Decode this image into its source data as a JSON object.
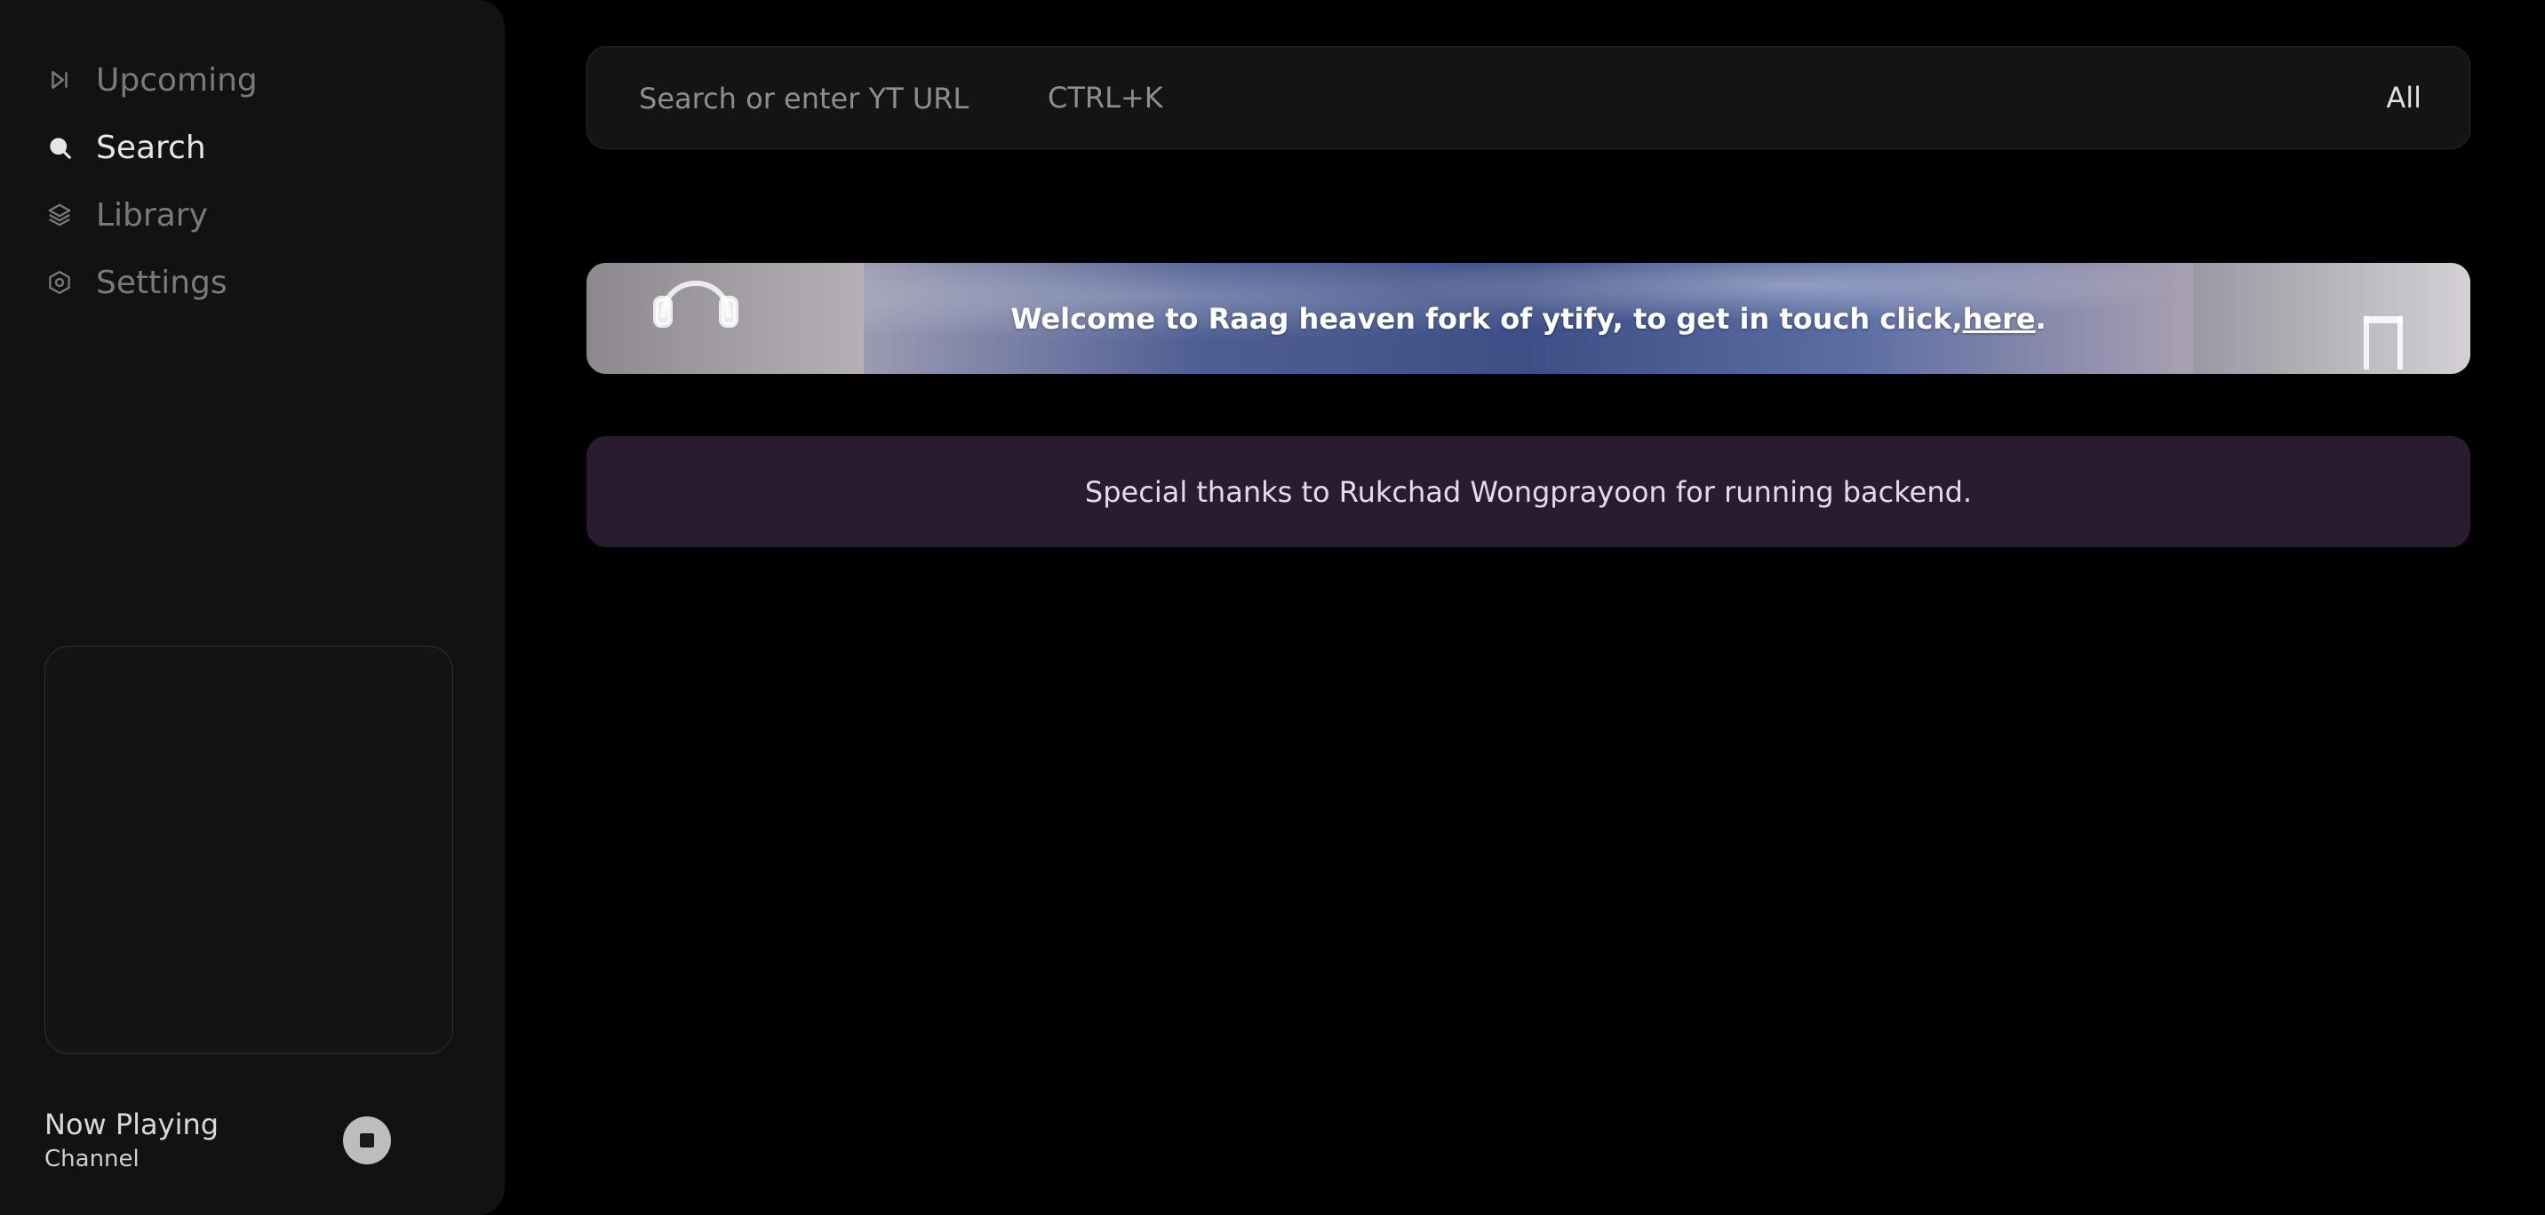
{
  "sidebar": {
    "items": [
      {
        "label": "Upcoming",
        "icon": "play-next-icon",
        "active": false
      },
      {
        "label": "Search",
        "icon": "search-icon",
        "active": true
      },
      {
        "label": "Library",
        "icon": "layers-icon",
        "active": false
      },
      {
        "label": "Settings",
        "icon": "settings-hexagon-icon",
        "active": false
      }
    ],
    "now_playing": {
      "title": "Now Playing",
      "channel": "Channel"
    }
  },
  "search": {
    "placeholder": "Search or enter YT URL",
    "shortcut": "CTRL+K",
    "filter": "All"
  },
  "banner": {
    "text_before": "Welcome to Raag heaven fork of ytify, to get in touch click, ",
    "link": "here",
    "text_after": "."
  },
  "thanks": {
    "text": "Special thanks to Rukchad Wongprayoon for running backend."
  },
  "colors": {
    "background": "#000000",
    "sidebar": "#121212",
    "thanks_bg": "#2b1b30",
    "muted_text": "#7a7a7a",
    "active_text": "#e6e6e6"
  }
}
